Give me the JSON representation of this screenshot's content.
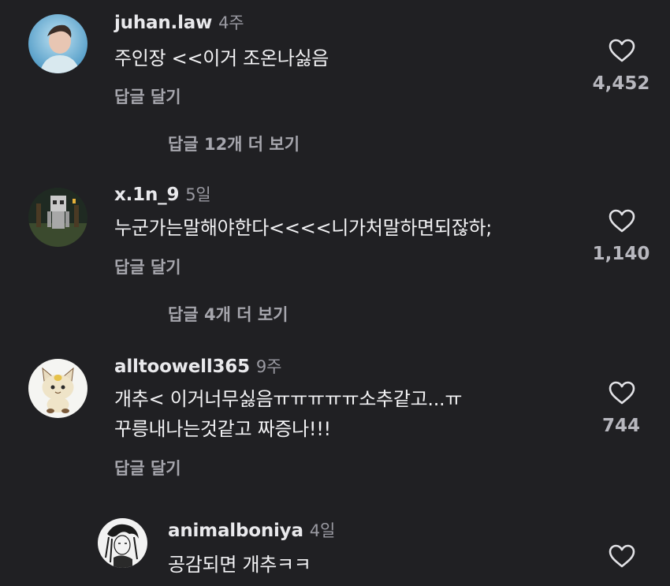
{
  "comments": [
    {
      "username": "juhan.law",
      "time": "4주",
      "text_lines": [
        "주인장 <<이거 조온나싫음"
      ],
      "reply_label": "답글 달기",
      "likes": "4,452",
      "more_replies": "답글 12개 더 보기",
      "avatar_icon": "person-photo-avatar"
    },
    {
      "username": "x.1n_9",
      "time": "5일",
      "text_lines": [
        "누군가는말해야한다<<<<니가처말하면되잖하;"
      ],
      "reply_label": "답글 달기",
      "likes": "1,140",
      "more_replies": "답글 4개 더 보기",
      "avatar_icon": "minecraft-skeleton-avatar"
    },
    {
      "username": "alltoowell365",
      "time": "9주",
      "text_lines": [
        "개추< 이거너무싫음ㅠㅠㅠㅠㅠ소추같고...ㅠ",
        "꾸릉내나는것같고 짜증나!!!"
      ],
      "reply_label": "답글 달기",
      "likes": "744",
      "avatar_icon": "meowth-plush-avatar"
    },
    {
      "username": "animalboniya",
      "time": "4일",
      "text_lines": [
        "공감되면 개추ㅋㅋ"
      ],
      "avatar_icon": "sketch-drawing-avatar"
    }
  ],
  "colors": {
    "background": "#202023",
    "primary_text": "#f2f2f4",
    "secondary_text": "#a6a6ad"
  }
}
